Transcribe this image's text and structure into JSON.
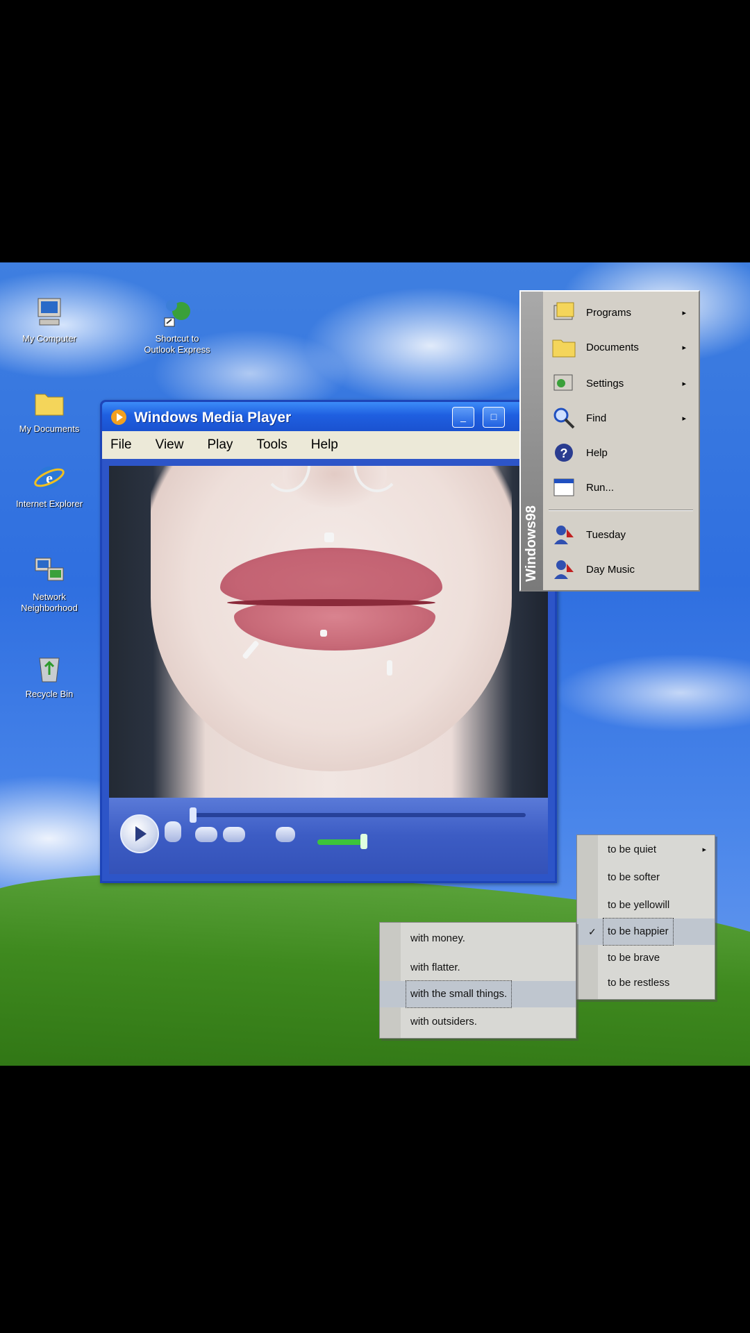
{
  "desktop": {
    "icons": [
      {
        "label": "My Computer"
      },
      {
        "label": "Shortcut to Outlook Express"
      },
      {
        "label": "My Documents"
      },
      {
        "label": "Internet Explorer"
      },
      {
        "label": "Network Neighborhood"
      },
      {
        "label": "Recycle Bin"
      }
    ]
  },
  "wmp": {
    "title": "Windows Media Player",
    "menu": [
      "File",
      "View",
      "Play",
      "Tools",
      "Help"
    ],
    "buttons": {
      "minimize": "_",
      "maximize": "□"
    }
  },
  "start_menu": {
    "band_label": "Windows98",
    "items": [
      {
        "label": "Programs",
        "submenu": "▸"
      },
      {
        "label": "Documents",
        "submenu": "▸"
      },
      {
        "label": "Settings",
        "submenu": "▸"
      },
      {
        "label": "Find",
        "submenu": "▸"
      },
      {
        "label": "Help"
      },
      {
        "label": "Run..."
      },
      {
        "label": "Tuesday"
      },
      {
        "label": "Day Music"
      }
    ]
  },
  "menu_feel": {
    "items": [
      {
        "label": "to be quiet",
        "submenu": "▸"
      },
      {
        "label": "to be softer"
      },
      {
        "label": "to be yellowill"
      },
      {
        "label": "to be happier",
        "check": "✓"
      },
      {
        "label": "to be brave"
      },
      {
        "label": "to be restless"
      }
    ]
  },
  "menu_with": {
    "items": [
      {
        "label": "with money."
      },
      {
        "label": "with flatter."
      },
      {
        "label": "with the small things."
      },
      {
        "label": "with outsiders."
      }
    ]
  },
  "colors": {
    "xp_title_blue": "#1f5fe0",
    "menu_gray": "#d8d8d4",
    "lip_red": "#c86a78"
  }
}
